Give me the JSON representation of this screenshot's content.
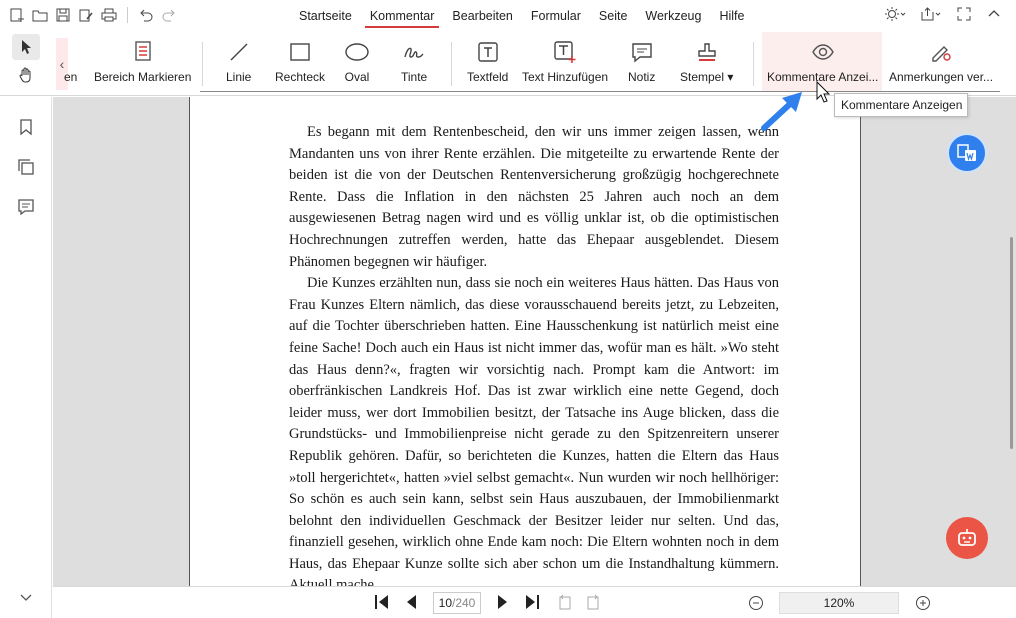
{
  "menubar": {
    "tabs": [
      "Startseite",
      "Kommentar",
      "Bearbeiten",
      "Formular",
      "Seite",
      "Werkzeug",
      "Hilfe"
    ],
    "active_tab": "Kommentar"
  },
  "ribbon": {
    "partial_label": "en",
    "tools": {
      "bereich": "Bereich Markieren",
      "linie": "Linie",
      "rechteck": "Rechteck",
      "oval": "Oval",
      "tinte": "Tinte",
      "textfeld": "Textfeld",
      "text_hinzufuegen": "Text Hinzufügen",
      "notiz": "Notiz",
      "stempel": "Stempel ▾",
      "kommentare_anzeigen": "Kommentare Anzei...",
      "anmerkungen": "Anmerkungen ver..."
    }
  },
  "tooltip": "Kommentare Anzeigen",
  "document": {
    "paragraphs": [
      "Es begann mit dem Rentenbescheid, den wir uns immer zeigen lassen, wenn Mandanten uns von ihrer Rente erzählen. Die mitgeteilte zu erwartende Rente der beiden ist die von der Deutschen Rentenversicherung großzügig hochgerechnete Rente. Dass die Inflation in den nächsten 25 Jahren auch noch an dem ausgewiesenen Betrag nagen wird und es völlig unklar ist, ob die optimistischen Hochrechnungen zutreffen werden, hatte das Ehepaar ausgeblendet. Diesem Phänomen begegnen wir häufiger.",
      "Die Kunzes erzählten nun, dass sie noch ein weiteres Haus hätten. Das Haus von Frau Kunzes Eltern nämlich, das diese vorausschauend bereits jetzt, zu Lebzeiten, auf die Tochter überschrieben hatten. Eine Hausschenkung ist natürlich meist eine feine Sache! Doch auch ein Haus ist nicht immer das, wofür man es hält. »Wo steht das Haus denn?«, fragten wir vorsichtig nach. Prompt kam die Antwort: im oberfränkischen Landkreis Hof. Das ist zwar wirklich eine nette Gegend, doch leider muss, wer dort Immobilien besitzt, der Tatsache ins Auge blicken, dass die Grundstücks- und Immobilienpreise nicht gerade zu den Spitzenreitern unserer Republik gehören. Dafür, so berichteten die Kunzes, hatten die Eltern das Haus »toll hergerichtet«, hatten »viel selbst gemacht«. Nun wurden wir noch hellhöriger: So schön es auch sein kann, selbst sein Haus auszubauen, der Immobilienmarkt belohnt den individuellen Geschmack der Besitzer leider nur selten. Und das, finanziell gesehen, wirklich ohne Ende kam noch: Die Eltern wohnten noch in dem Haus, das Ehepaar Kunze sollte sich aber schon um die Instandhaltung kümmern. Aktuell mache"
    ]
  },
  "pagination": {
    "current": "10",
    "total": "/240"
  },
  "zoom": "120%",
  "colors": {
    "accent": "#d63b3b",
    "fab_blue": "#2f80ed",
    "fab_red": "#ea5545"
  }
}
